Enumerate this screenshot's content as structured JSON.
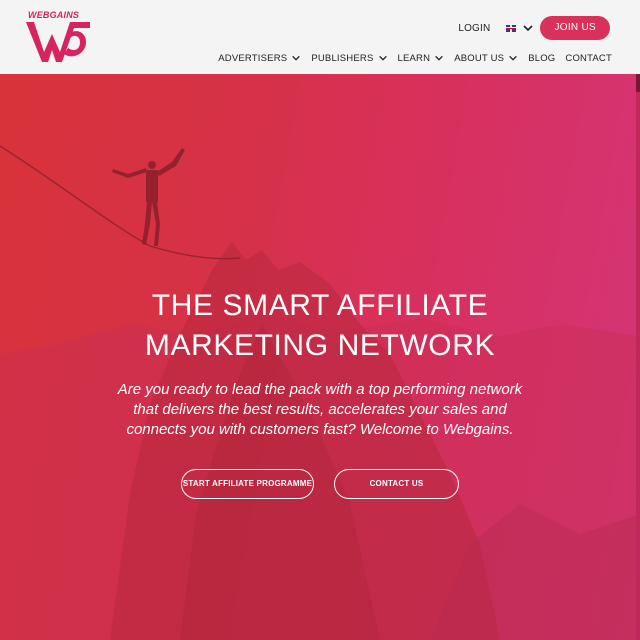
{
  "brand": {
    "name": "WEBGAINS",
    "color": "#d6245e"
  },
  "header": {
    "login_label": "LOGIN",
    "language_icon": "uk-flag-icon",
    "join_label": "JOIN US",
    "nav": [
      {
        "label": "ADVERTISERS",
        "has_dropdown": true
      },
      {
        "label": "PUBLISHERS",
        "has_dropdown": true
      },
      {
        "label": "LEARN",
        "has_dropdown": true
      },
      {
        "label": "ABOUT US",
        "has_dropdown": true
      },
      {
        "label": "BLOG",
        "has_dropdown": false
      },
      {
        "label": "CONTACT",
        "has_dropdown": false
      }
    ]
  },
  "hero": {
    "title_line1": "THE SMART AFFILIATE",
    "title_line2": "MARKETING NETWORK",
    "subtitle": "Are you ready to lead the pack with a top performing network that delivers the best results, accelerates your sales and connects you with customers fast? Welcome to Webgains.",
    "cta_primary": "START AFFILIATE PROGRAMME",
    "cta_secondary": "CONTACT US",
    "gradient_colors": [
      "#d8333a",
      "#d4357a"
    ]
  }
}
